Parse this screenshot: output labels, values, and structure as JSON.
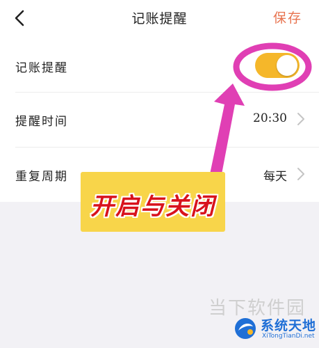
{
  "header": {
    "back_icon": "chevron-left-icon",
    "title": "记账提醒",
    "save_label": "保存"
  },
  "settings": [
    {
      "label": "记账提醒",
      "control": "toggle",
      "enabled": true
    },
    {
      "label": "提醒时间",
      "value": "20:30",
      "chevron_icon": "chevron-right-icon"
    },
    {
      "label": "重复周期",
      "value": "每天",
      "chevron_icon": "chevron-right-icon"
    }
  ],
  "annotation": {
    "text": "开启与关闭",
    "highlight_color": "#e03fb4",
    "box_color": "#f8d54a",
    "text_color": "#d8121c"
  },
  "watermark": {
    "faded_text": "当下软件园",
    "brand": "系统天地",
    "url": "XiTongTianDi.net"
  },
  "colors": {
    "accent": "#e8734f",
    "toggle_on": "#f5b72a",
    "background_gray": "#f2f1f5"
  }
}
